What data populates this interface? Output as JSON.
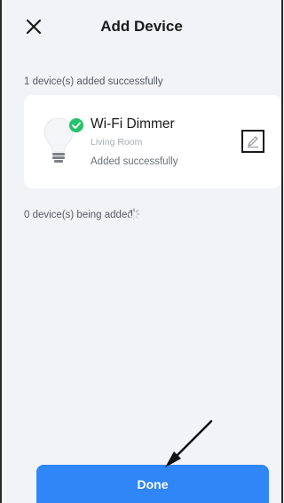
{
  "header": {
    "title": "Add Device",
    "close_icon": "close-icon"
  },
  "added_section": {
    "label": "1 device(s) added successfully",
    "device": {
      "name": "Wi-Fi Dimmer",
      "room": "Living Room",
      "status": "Added successfully",
      "icon": "light-bulb-icon",
      "status_icon": "check-circle-icon",
      "action_icon": "edit-pencil-icon"
    }
  },
  "pending_section": {
    "label": "0 device(s) being added",
    "icon": "loading-spinner-icon"
  },
  "footer": {
    "done_label": "Done"
  },
  "colors": {
    "accent": "#2f86f6",
    "success": "#25c26b",
    "background": "#f2f3f7"
  }
}
